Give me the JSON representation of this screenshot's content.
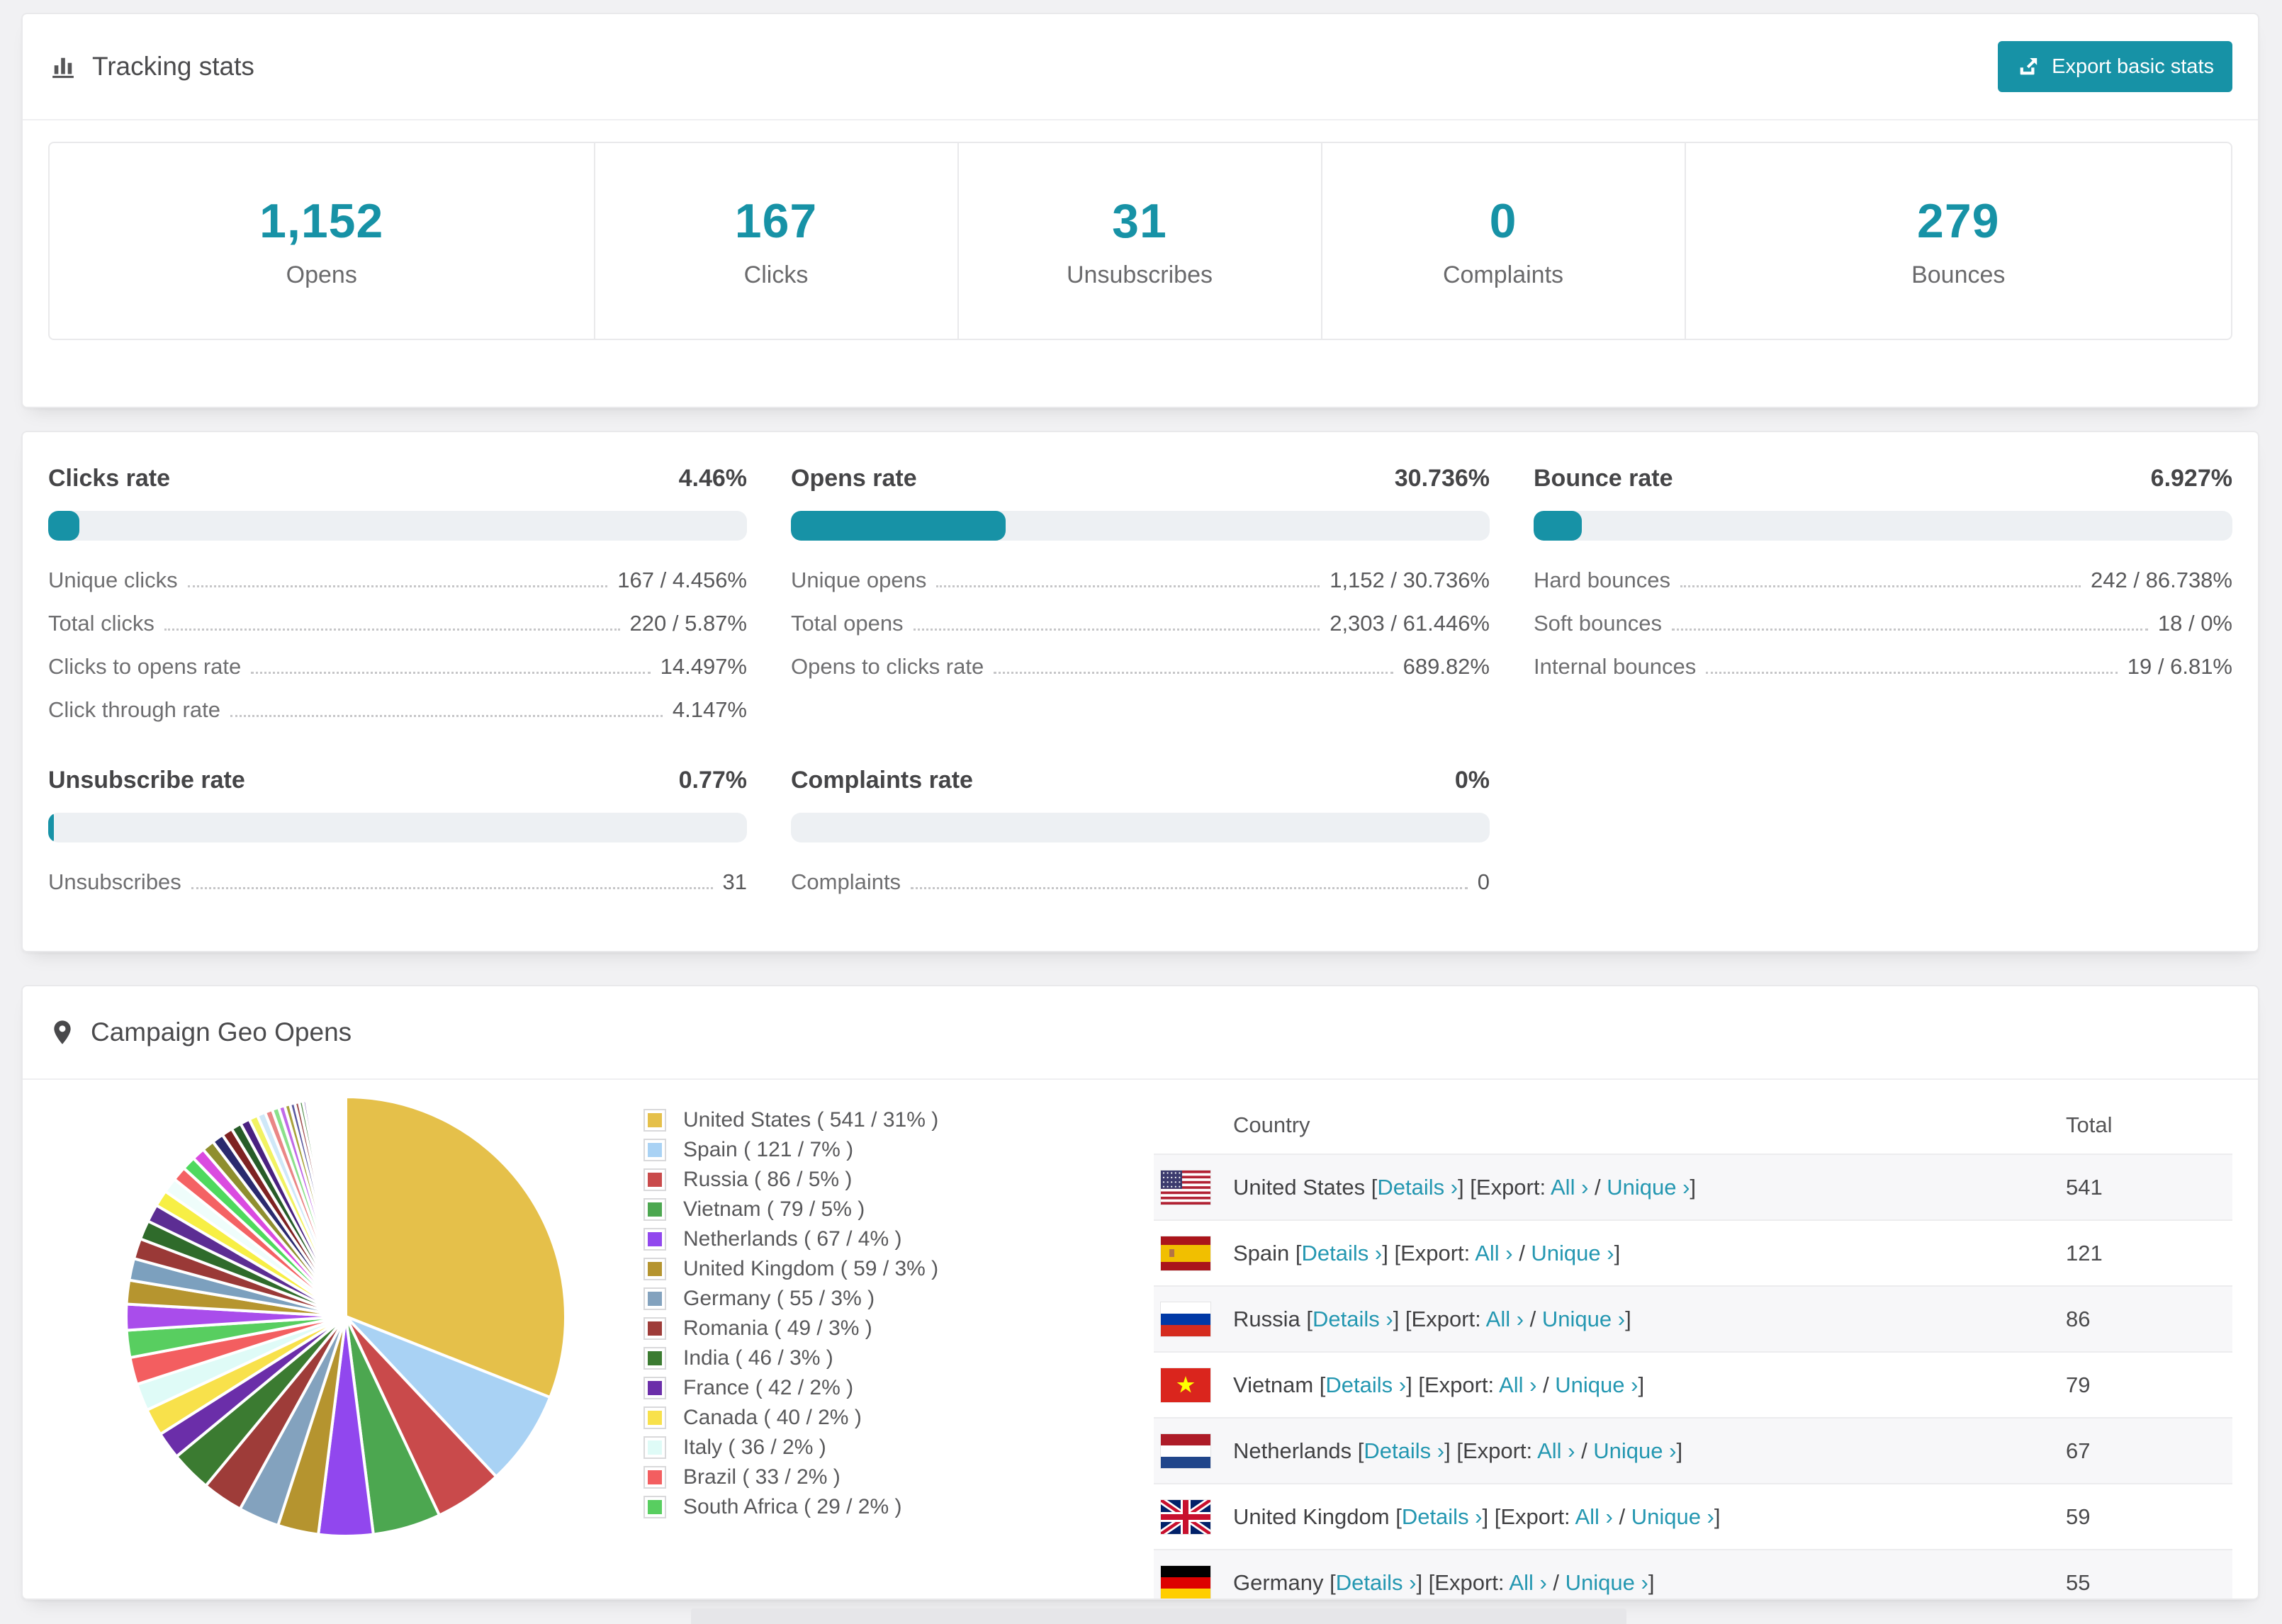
{
  "colors": {
    "accent": "#1792A6",
    "link": "#2497B1",
    "bar_track": "#EDF0F3",
    "row_stripe": "#F7F7F9",
    "page_bg": "#F1F1F3"
  },
  "tracking": {
    "title": "Tracking stats",
    "export_button_label": "Export basic stats",
    "stats": [
      {
        "value": "1,152",
        "label": "Opens"
      },
      {
        "value": "167",
        "label": "Clicks"
      },
      {
        "value": "31",
        "label": "Unsubscribes"
      },
      {
        "value": "0",
        "label": "Complaints"
      },
      {
        "value": "279",
        "label": "Bounces"
      }
    ]
  },
  "rates": [
    {
      "title": "Clicks rate",
      "value": "4.46%",
      "percent": 4.46,
      "rows": [
        [
          "Unique clicks",
          "167 / 4.456%"
        ],
        [
          "Total clicks",
          "220 / 5.87%"
        ],
        [
          "Clicks to opens rate",
          "14.497%"
        ],
        [
          "Click through rate",
          "4.147%"
        ]
      ]
    },
    {
      "title": "Opens rate",
      "value": "30.736%",
      "percent": 30.736,
      "rows": [
        [
          "Unique opens",
          "1,152 / 30.736%"
        ],
        [
          "Total opens",
          "2,303 / 61.446%"
        ],
        [
          "Opens to clicks rate",
          "689.82%"
        ]
      ]
    },
    {
      "title": "Bounce rate",
      "value": "6.927%",
      "percent": 6.927,
      "rows": [
        [
          "Hard bounces",
          "242 / 86.738%"
        ],
        [
          "Soft bounces",
          "18 / 0%"
        ],
        [
          "Internal bounces",
          "19 / 6.81%"
        ]
      ]
    },
    {
      "title": "Unsubscribe rate",
      "value": "0.77%",
      "percent": 0.77,
      "rows": [
        [
          "Unsubscribes",
          "31"
        ]
      ]
    },
    {
      "title": "Complaints rate",
      "value": "0%",
      "percent": 0,
      "rows": [
        [
          "Complaints",
          "0"
        ]
      ]
    }
  ],
  "geo": {
    "title": "Campaign Geo Opens",
    "table": {
      "headers": {
        "country": "Country",
        "total": "Total"
      },
      "link_labels": {
        "details": "Details ›",
        "export": "Export:",
        "all": "All ›",
        "unique": "Unique ›"
      }
    },
    "countries": [
      {
        "name": "United States",
        "total": "541",
        "percent": 31,
        "color": "#E5C04A",
        "flag": "us"
      },
      {
        "name": "Spain",
        "total": "121",
        "percent": 7,
        "color": "#A9D2F4",
        "flag": "es"
      },
      {
        "name": "Russia",
        "total": "86",
        "percent": 5,
        "color": "#C94A4B",
        "flag": "ru"
      },
      {
        "name": "Vietnam",
        "total": "79",
        "percent": 5,
        "color": "#4CA750",
        "flag": "vn"
      },
      {
        "name": "Netherlands",
        "total": "67",
        "percent": 4,
        "color": "#9147EE",
        "flag": "nl"
      },
      {
        "name": "United Kingdom",
        "total": "59",
        "percent": 3,
        "color": "#B5942F",
        "flag": "gb"
      },
      {
        "name": "Germany",
        "total": "55",
        "percent": 3,
        "color": "#83A2BE",
        "flag": "de"
      },
      {
        "name": "Romania",
        "total": "49",
        "percent": 3,
        "color": "#9E3C39",
        "flag": "ro"
      },
      {
        "name": "India",
        "total": "46",
        "percent": 3,
        "color": "#3B7B31",
        "flag": "in"
      },
      {
        "name": "France",
        "total": "42",
        "percent": 2,
        "color": "#6B2EA9",
        "flag": "fr"
      },
      {
        "name": "Canada",
        "total": "40",
        "percent": 2,
        "color": "#F8E14B",
        "flag": "ca"
      },
      {
        "name": "Italy",
        "total": "36",
        "percent": 2,
        "color": "#DFFBF7",
        "flag": "it"
      },
      {
        "name": "Brazil",
        "total": "33",
        "percent": 2,
        "color": "#F35E60",
        "flag": "br"
      },
      {
        "name": "South Africa",
        "total": "29",
        "percent": 2,
        "color": "#58CE60",
        "flag": "za"
      }
    ],
    "table_visible_rows": 7
  },
  "chart_data": {
    "type": "pie",
    "title": "Campaign Geo Opens",
    "legend_position": "right",
    "start_angle_deg": 0,
    "direction": "clockwise",
    "slices": [
      {
        "label": "United States",
        "value": 541,
        "percent": 31,
        "color": "#E5C04A"
      },
      {
        "label": "Spain",
        "value": 121,
        "percent": 7,
        "color": "#A9D2F4"
      },
      {
        "label": "Russia",
        "value": 86,
        "percent": 5,
        "color": "#C94A4B"
      },
      {
        "label": "Vietnam",
        "value": 79,
        "percent": 5,
        "color": "#4CA750"
      },
      {
        "label": "Netherlands",
        "value": 67,
        "percent": 4,
        "color": "#9147EE"
      },
      {
        "label": "United Kingdom",
        "value": 59,
        "percent": 3,
        "color": "#B5942F"
      },
      {
        "label": "Germany",
        "value": 55,
        "percent": 3,
        "color": "#83A2BE"
      },
      {
        "label": "Romania",
        "value": 49,
        "percent": 3,
        "color": "#9E3C39"
      },
      {
        "label": "India",
        "value": 46,
        "percent": 3,
        "color": "#3B7B31"
      },
      {
        "label": "France",
        "value": 42,
        "percent": 2,
        "color": "#6B2EA9"
      },
      {
        "label": "Canada",
        "value": 40,
        "percent": 2,
        "color": "#F8E14B"
      },
      {
        "label": "Italy",
        "value": 36,
        "percent": 2,
        "color": "#DFFBF7"
      },
      {
        "label": "Brazil",
        "value": 33,
        "percent": 2,
        "color": "#F35E60"
      },
      {
        "label": "South Africa",
        "value": 29,
        "percent": 2,
        "color": "#58CE60"
      }
    ],
    "unlabeled_small_slices": {
      "note": "many thin unlabeled slices fill the remainder of the pie",
      "percents": [
        1.9,
        1.75,
        1.6,
        1.5,
        1.4,
        1.3,
        1.2,
        1.1,
        1.05,
        1.0,
        0.95,
        0.9,
        0.85,
        0.8,
        0.75,
        0.7,
        0.65,
        0.6,
        0.55,
        0.5,
        0.45,
        0.4,
        0.36,
        0.32,
        0.28,
        0.24,
        0.2,
        0.17,
        0.14,
        0.12,
        0.1,
        0.08,
        0.07,
        0.06,
        0.05,
        0.04
      ],
      "colors": [
        "#A94DEB",
        "#B6952F",
        "#7CA0BE",
        "#9A3937",
        "#2F6B2B",
        "#5C2D93",
        "#F7EF45",
        "#EFFDFB",
        "#F46264",
        "#4FD95E",
        "#DA4BE0",
        "#8F8F2F",
        "#2A2A6E",
        "#7E2222",
        "#275C28",
        "#4A2180",
        "#F2F261",
        "#CFE8F8",
        "#EA8686",
        "#8BE08B",
        "#C06AE8",
        "#A8A23B",
        "#5A5AA0",
        "#A05050",
        "#4E8C4A",
        "#7A55B0",
        "#EDE06A",
        "#BFE9EC",
        "#F0A0A0",
        "#A5E5A5",
        "#D58FE8",
        "#B8B060",
        "#8080B8",
        "#B87878",
        "#78A878",
        "#9B7BC8"
      ]
    }
  }
}
